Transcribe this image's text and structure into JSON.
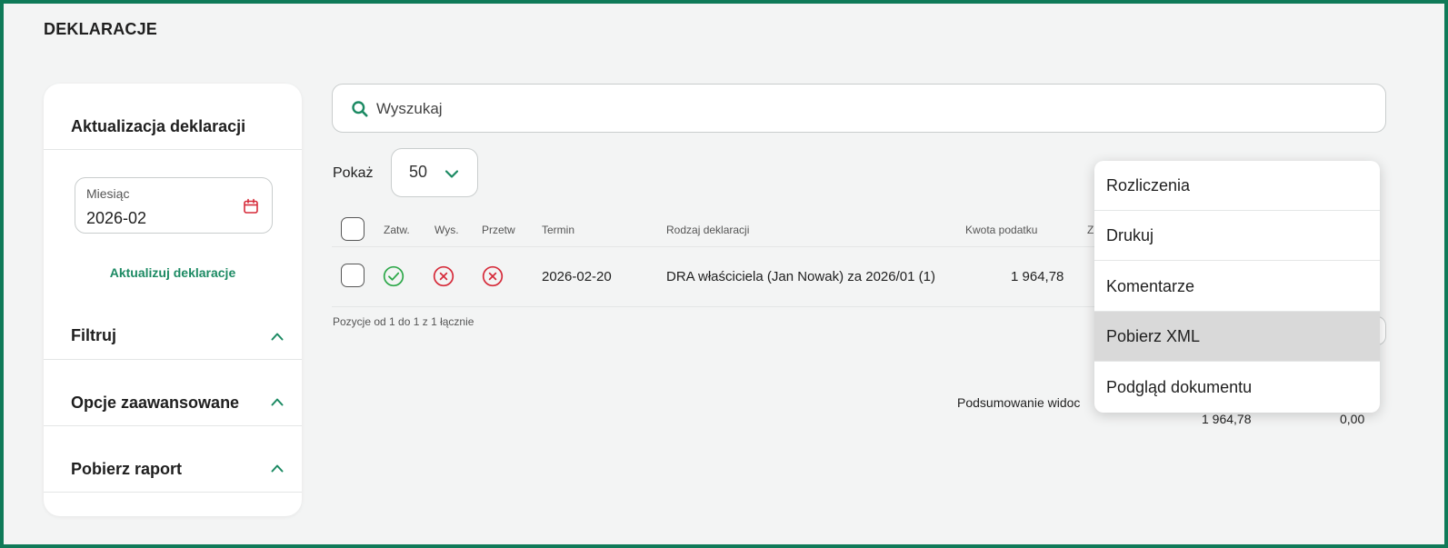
{
  "page": {
    "title": "DEKLARACJE"
  },
  "colors": {
    "frame": "#0f7a58",
    "accent": "#1c8a63",
    "ok": "#2ea84a",
    "error": "#d62b3a"
  },
  "sidebar": {
    "update_section_title": "Aktualizacja deklaracji",
    "month_field": {
      "label": "Miesiąc",
      "value": "2026-02",
      "icon": "calendar-icon"
    },
    "update_link": "Aktualizuj deklaracje",
    "sections": [
      {
        "label": "Filtruj",
        "expanded": true
      },
      {
        "label": "Opcje zaawansowane",
        "expanded": true
      },
      {
        "label": "Pobierz raport",
        "expanded": true
      }
    ]
  },
  "search": {
    "placeholder": "Wyszukaj"
  },
  "page_size": {
    "label": "Pokaż",
    "value": "50"
  },
  "table": {
    "headers": {
      "approved": "Zatw.",
      "sent": "Wys.",
      "processed": "Przetw",
      "due": "Termin",
      "type": "Rodzaj deklaracji",
      "tax_amount": "Kwota podatku",
      "cut": "Z"
    },
    "rows": [
      {
        "approved": "ok",
        "sent": "error",
        "processed": "error",
        "due": "2026-02-20",
        "type": "DRA właściciela (Jan Nowak) za 2026/01 (1)",
        "tax_amount": "1 964,78"
      }
    ],
    "info": "Pozycje od 1 do 1 z 1 łącznie"
  },
  "summary": {
    "label": "Podsumowanie widoc",
    "values": [
      "1 964,78",
      "0,00"
    ]
  },
  "context_menu": {
    "items": [
      {
        "label": "Rozliczenia",
        "highlighted": false
      },
      {
        "label": "Drukuj",
        "highlighted": false
      },
      {
        "label": "Komentarze",
        "highlighted": false
      },
      {
        "label": "Pobierz XML",
        "highlighted": true
      },
      {
        "label": "Podgląd dokumentu",
        "highlighted": false
      }
    ]
  }
}
